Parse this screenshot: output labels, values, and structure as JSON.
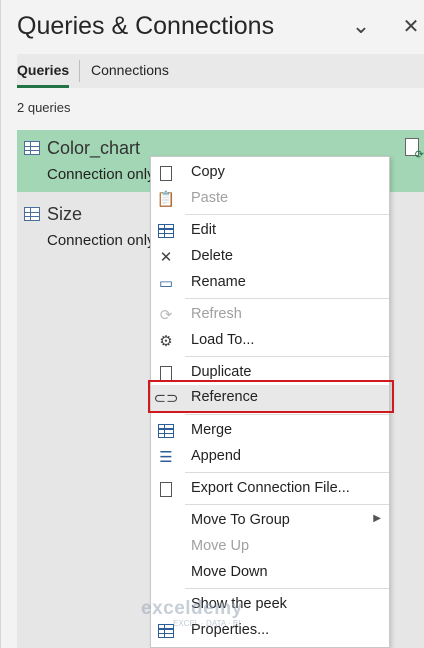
{
  "header": {
    "title": "Queries & Connections",
    "collapse_icon": "chevron-down-icon",
    "close_icon": "close-icon"
  },
  "tabs": [
    {
      "label": "Queries",
      "active": true
    },
    {
      "label": "Connections",
      "active": false
    }
  ],
  "query_count": "2 queries",
  "queries": [
    {
      "name": "Color_chart",
      "status": "Connection only.",
      "selected": true
    },
    {
      "name": "Size",
      "status": "Connection only.",
      "selected": false
    }
  ],
  "context_menu": {
    "items": [
      {
        "label": "Copy",
        "icon": "copy-icon",
        "enabled": true
      },
      {
        "label": "Paste",
        "icon": "paste-icon",
        "enabled": false
      },
      {
        "label": "Edit",
        "icon": "edit-icon",
        "enabled": true
      },
      {
        "label": "Delete",
        "icon": "delete-icon",
        "enabled": true
      },
      {
        "label": "Rename",
        "icon": "rename-icon",
        "enabled": true
      },
      {
        "label": "Refresh",
        "icon": "refresh-icon",
        "enabled": false
      },
      {
        "label": "Load To...",
        "icon": "load-to-icon",
        "enabled": true
      },
      {
        "label": "Duplicate",
        "icon": "duplicate-icon",
        "enabled": true
      },
      {
        "label": "Reference",
        "icon": "link-icon",
        "enabled": true,
        "highlighted": true
      },
      {
        "label": "Merge",
        "icon": "merge-icon",
        "enabled": true
      },
      {
        "label": "Append",
        "icon": "append-icon",
        "enabled": true
      },
      {
        "label": "Export Connection File...",
        "icon": "export-icon",
        "enabled": true
      },
      {
        "label": "Move To Group",
        "icon": "",
        "enabled": true,
        "submenu": true
      },
      {
        "label": "Move Up",
        "icon": "",
        "enabled": false
      },
      {
        "label": "Move Down",
        "icon": "",
        "enabled": true
      },
      {
        "label": "Show the peek",
        "icon": "",
        "enabled": true
      },
      {
        "label": "Properties...",
        "icon": "properties-icon",
        "enabled": true
      }
    ]
  },
  "watermark": {
    "brand": "exceldemy",
    "tagline": "EXCEL · DATA · BI"
  },
  "colors": {
    "selected_row": "#a2d6b4",
    "tab_underline": "#217346",
    "highlight_box": "#d0181f"
  }
}
